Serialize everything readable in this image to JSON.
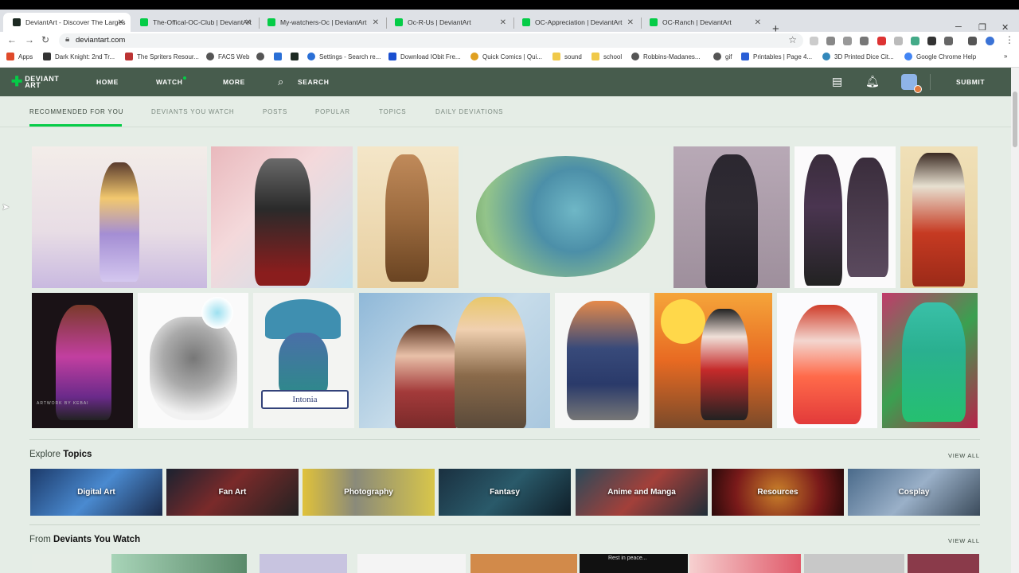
{
  "browser": {
    "tabs": [
      {
        "title": "DeviantArt - Discover The Larges",
        "active": true
      },
      {
        "title": "The-Offical-OC-Club | DeviantArt"
      },
      {
        "title": "My-watchers-Oc | DeviantArt"
      },
      {
        "title": "Oc-R-Us | DeviantArt"
      },
      {
        "title": "OC-Appreciation | DeviantArt"
      },
      {
        "title": "OC-Ranch | DeviantArt"
      }
    ],
    "url": "deviantart.com",
    "bookmarks": [
      "Apps",
      "Dark Knight: 2nd Tr...",
      "The Spriters Resour...",
      "FACS Web",
      "",
      "",
      "Settings - Search re...",
      "Download IObit Fre...",
      "Quick Comics | Qui...",
      "sound",
      "school",
      "Robbins-Madanes...",
      "gif",
      "Printables | Page 4...",
      "3D Printed Dice Cit...",
      "Google Chrome Help"
    ]
  },
  "site": {
    "logo": {
      "line1": "DEVIANT",
      "line2": "ART"
    },
    "nav": {
      "home": "HOME",
      "watch": "WATCH",
      "more": "MORE",
      "search": "SEARCH",
      "submit": "SUBMIT"
    },
    "subtabs": [
      "RECOMMENDED FOR YOU",
      "DEVIANTS YOU WATCH",
      "POSTS",
      "POPULAR",
      "TOPICS",
      "DAILY DEVIATIONS"
    ],
    "artwork_labels": {
      "intonia": "Intonia",
      "signature": "ARTWORK BY KEBAI"
    },
    "explore": {
      "prefix": "Explore",
      "bold": "Topics",
      "view_all": "VIEW ALL"
    },
    "topics": [
      "Digital Art",
      "Fan Art",
      "Photography",
      "Fantasy",
      "Anime and Manga",
      "Resources",
      "Cosplay"
    ],
    "deviants": {
      "prefix": "From",
      "bold": "Deviants You Watch",
      "view_all": "VIEW ALL"
    },
    "bottom_caption": "Rest in peace..."
  },
  "colors": {
    "accent": "#05cc47",
    "nav_bg": "#475c4d",
    "page_bg": "#e5ede6"
  }
}
